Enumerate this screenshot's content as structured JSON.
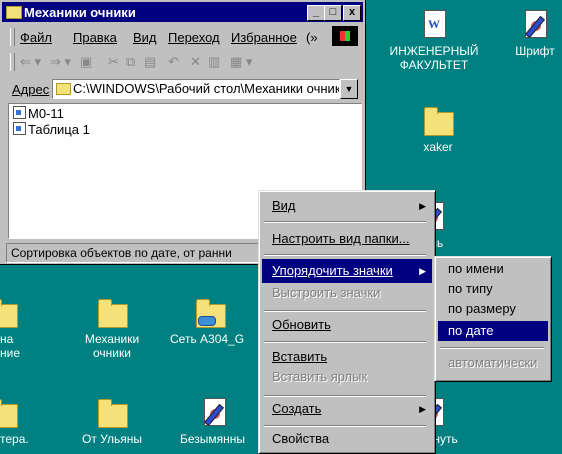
{
  "window": {
    "title": "Механики очники",
    "min_btn": "_",
    "max_btn": "□",
    "close_btn": "x",
    "menu": [
      "Файл",
      "Правка",
      "Вид",
      "Переход",
      "Избранное",
      "(»"
    ],
    "toolbar_glyphs": [
      "⇐ ▾",
      "⇒ ▾",
      "▣",
      "✂",
      "⧉",
      "▤",
      "↶",
      "✕",
      "▥",
      "▦ ▾"
    ],
    "address_label": "Адрес",
    "address_value": "C:\\WINDOWS\\Рабочий стол\\Механики очник",
    "files": [
      "М0-11",
      "Таблица 1"
    ],
    "status_text": "Сортировка объектов по дате, от ранни"
  },
  "desktop_icons": {
    "ing": "ИНЖЕНЕРНЫЙ ФАКУЛЬТЕТ",
    "shrift": "Шрифт",
    "xaker": "xaker",
    "atel": "атель",
    "na": "на ние",
    "mech": "Механики очники",
    "set": "Сеть A304_G",
    "tera": "тера.",
    "ulyany": "От Ульяны",
    "bezym": "Безымянны",
    "vernut": "ернуть"
  },
  "context_menu": {
    "items": [
      {
        "label": "Вид",
        "state": "normal",
        "submenu": true
      },
      {
        "label": "Настроить вид папки...",
        "state": "normal"
      },
      {
        "label": "Упорядочить значки",
        "state": "selected",
        "submenu": true
      },
      {
        "label": "Выстроить значки",
        "state": "disabled"
      },
      {
        "label": "Обновить",
        "state": "normal"
      },
      {
        "label": "Вставить",
        "state": "normal"
      },
      {
        "label": "Вставить ярлык",
        "state": "disabled"
      },
      {
        "label": "Создать",
        "state": "normal",
        "submenu": true
      },
      {
        "label": "Свойства",
        "state": "normal"
      }
    ]
  },
  "sub_menu": {
    "items": [
      {
        "label": "по имени",
        "state": "normal"
      },
      {
        "label": "по типу",
        "state": "normal"
      },
      {
        "label": "по размеру",
        "state": "normal"
      },
      {
        "label": "по дате",
        "state": "selected"
      },
      {
        "label": "автоматически",
        "state": "disabled"
      }
    ]
  },
  "colors": {
    "desktop": "#008080",
    "title": "#000080",
    "selection": "#000080",
    "face": "#c0c0c0"
  }
}
